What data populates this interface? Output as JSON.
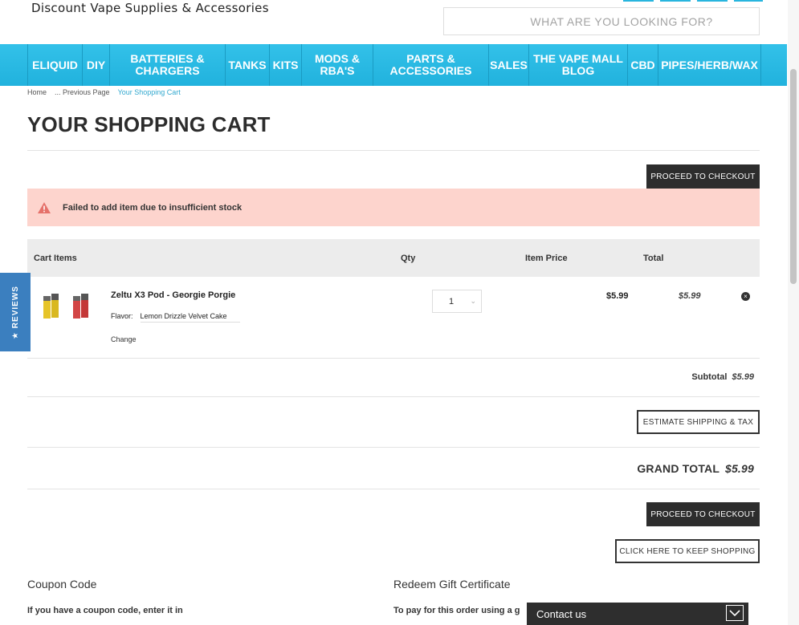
{
  "header": {
    "tagline": "Discount Vape Supplies & Accessories",
    "search_placeholder": "WHAT ARE YOU LOOKING FOR?"
  },
  "nav": {
    "items": [
      {
        "label": "ELIQUID"
      },
      {
        "label": "DIY"
      },
      {
        "label": "BATTERIES & CHARGERS"
      },
      {
        "label": "TANKS"
      },
      {
        "label": "KITS"
      },
      {
        "label": "MODS & RBA'S"
      },
      {
        "label": "PARTS & ACCESSORIES"
      },
      {
        "label": "SALES"
      },
      {
        "label": "THE VAPE MALL BLOG"
      },
      {
        "label": "CBD"
      },
      {
        "label": "PIPES/HERB/WAX"
      }
    ]
  },
  "breadcrumb": {
    "home": "Home",
    "previous": "... Previous Page",
    "current": "Your Shopping Cart"
  },
  "page_title": "YOUR SHOPPING CART",
  "buttons": {
    "checkout": "PROCEED TO CHECKOUT",
    "estimate": "ESTIMATE SHIPPING & TAX",
    "keep_shopping": "CLICK HERE TO KEEP SHOPPING"
  },
  "alert": {
    "message": "Failed to add item due to insufficient stock",
    "icon": "warning-triangle-icon",
    "color": "#fdd4cd"
  },
  "cart": {
    "headers": {
      "items": "Cart Items",
      "qty": "Qty",
      "price": "Item Price",
      "total": "Total"
    },
    "item": {
      "name": "Zeltu X3 Pod - Georgie Porgie",
      "flavor_label": "Flavor:",
      "flavor_value": "Lemon Drizzle Velvet Cake",
      "change": "Change",
      "qty": "1",
      "price": "$5.99",
      "total": "$5.99"
    }
  },
  "totals": {
    "subtotal_label": "Subtotal",
    "subtotal_value": "$5.99",
    "grand_label": "GRAND TOTAL",
    "grand_value": "$5.99"
  },
  "sections": {
    "coupon_title": "Coupon Code",
    "coupon_text": "If you have a coupon code, enter it in",
    "gift_title": "Redeem Gift Certificate",
    "gift_text": "To pay for this order using a g"
  },
  "widgets": {
    "reviews": "★ REVIEWS",
    "contact": "Contact us"
  },
  "colors": {
    "accent": "#28b5de",
    "dark_button": "#2d2d2d",
    "reviews_tab": "#3b7fbf"
  }
}
